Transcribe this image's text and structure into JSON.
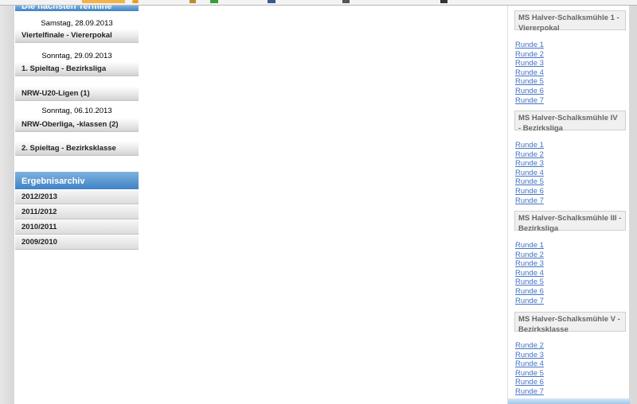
{
  "left": {
    "termine_header": "Die nächsten Termine",
    "blocks": [
      {
        "date": "Samstag, 28.09.2013",
        "event": "Viertelfinale  - Viererpokal"
      },
      {
        "date": "Sonntag, 29.09.2013",
        "event": "1. Spieltag  - Bezirksliga"
      },
      {
        "date": "",
        "event": "NRW-U20-Ligen (1)"
      },
      {
        "date": "Sonntag, 06.10.2013",
        "event": "NRW-Oberliga, -klassen (2)"
      },
      {
        "date": "",
        "event": "2. Spieltag  - Bezirksklasse"
      }
    ],
    "archive_header": "Ergebnisarchiv",
    "archive_items": [
      "2012/2013",
      "2011/2012",
      "2010/2011",
      "2009/2010"
    ]
  },
  "right": {
    "teams": [
      {
        "title": "MS Halver-Schalksmühle 1 - Viererpokal",
        "rounds": [
          "Runde 1",
          "Runde 2",
          "Runde 3",
          "Runde 4",
          "Runde 5",
          "Runde 6",
          "Runde 7"
        ]
      },
      {
        "title": "MS Halver-Schalksmühle IV - Bezirksliga",
        "rounds": [
          "Runde 1",
          "Runde 2",
          "Runde 3",
          "Runde 4",
          "Runde 5",
          "Runde 6",
          "Runde 7"
        ]
      },
      {
        "title": "MS Halver-Schalksmühle III - Bezirksliga",
        "rounds": [
          "Runde 1",
          "Runde 2",
          "Runde 3",
          "Runde 4",
          "Runde 5",
          "Runde 6",
          "Runde 7"
        ]
      },
      {
        "title": "MS Halver-Schalksmühle V - Bezirksklasse",
        "rounds": [
          "Runde 2",
          "Runde 3",
          "Runde 4",
          "Runde 5",
          "Runde 6",
          "Runde 7"
        ]
      }
    ]
  },
  "colors": {
    "header_blue": "#3e83c6",
    "link_blue": "#4472c4"
  }
}
